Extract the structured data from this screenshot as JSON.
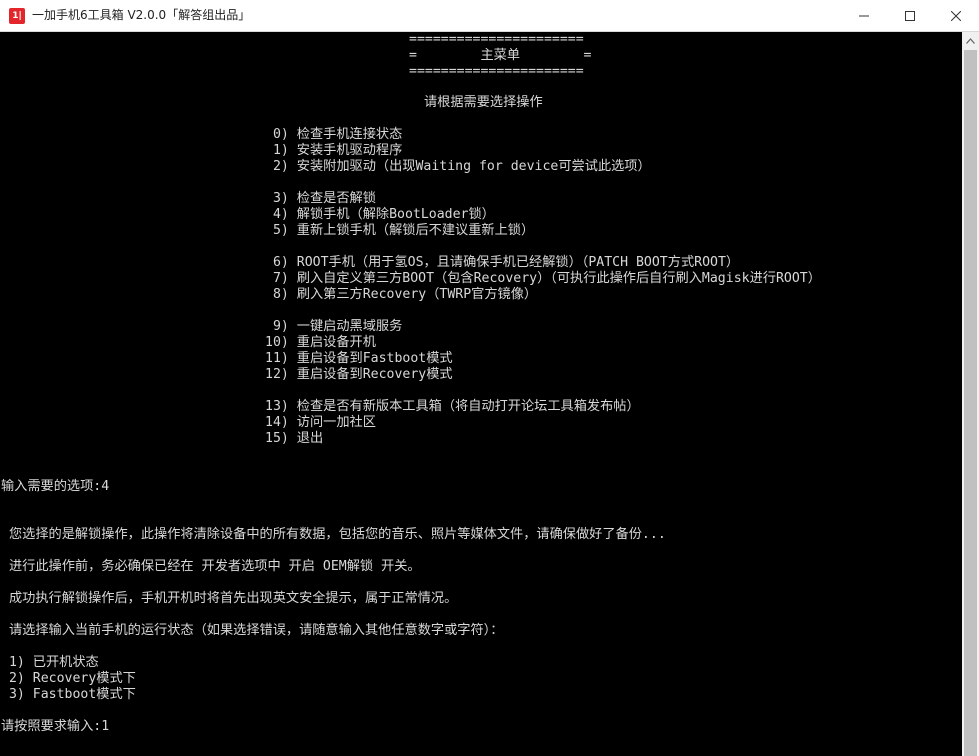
{
  "window": {
    "title": "一加手机6工具箱 V2.0.0「解答组出品」",
    "icon_label": "1|",
    "buttons": {
      "minimize_icon": "minimize-icon",
      "maximize_icon": "maximize-icon",
      "close_icon": "close-icon"
    }
  },
  "console": {
    "banner": [
      "======================",
      "=        主菜单        =",
      "======================"
    ],
    "prompt_heading": "请根据需要选择操作",
    "menu": [
      " 0) 检查手机连接状态",
      " 1) 安装手机驱动程序",
      " 2) 安装附加驱动（出现Waiting for device可尝试此选项）",
      " 3) 检查是否解锁",
      " 4) 解锁手机（解除BootLoader锁）",
      " 5) 重新上锁手机（解锁后不建议重新上锁）",
      " 6) ROOT手机（用于氢OS，且请确保手机已经解锁）（PATCH BOOT方式ROOT）",
      " 7) 刷入自定义第三方BOOT（包含Recovery）（可执行此操作后自行刷入Magisk进行ROOT）",
      " 8) 刷入第三方Recovery（TWRP官方镜像）",
      " 9) 一键启动黑域服务",
      "10) 重启设备开机",
      "11) 重启设备到Fastboot模式",
      "12) 重启设备到Recovery模式",
      "13) 检查是否有新版本工具箱（将自动打开论坛工具箱发布帖）",
      "14) 访问一加社区",
      "15) 退出"
    ],
    "input_line": "输入需要的选项:4",
    "messages": [
      " 您选择的是解锁操作，此操作将清除设备中的所有数据，包括您的音乐、照片等媒体文件，请确保做好了备份...",
      " 进行此操作前，务必确保已经在 开发者选项中 开启 OEM解锁 开关。",
      " 成功执行解锁操作后，手机开机时将首先出现英文安全提示，属于正常情况。",
      " 请选择输入当前手机的运行状态（如果选择错误，请随意输入其他任意数字或字符）："
    ],
    "states": [
      " 1) 已开机状态",
      " 2) Recovery模式下",
      " 3) Fastboot模式下"
    ],
    "final_input": "请按照要求输入:1"
  },
  "scrollbar": {
    "up_icon": "scroll-up-arrow-icon"
  }
}
